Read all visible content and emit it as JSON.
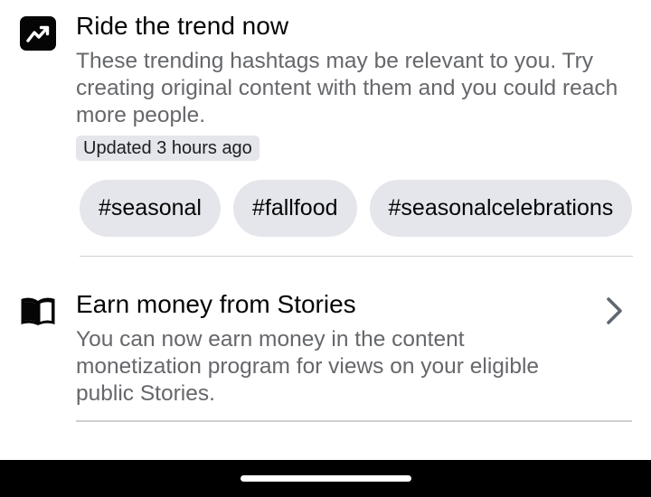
{
  "trend_card": {
    "icon": "trending-up-icon",
    "title": "Ride the trend now",
    "description": "These trending hashtags may be relevant to you. Try creating original content with them and you could reach more people.",
    "updated": "Updated 3 hours ago",
    "hashtags": [
      {
        "label": "#seasonal"
      },
      {
        "label": "#fallfood"
      },
      {
        "label": "#seasonalcelebrations"
      }
    ]
  },
  "stories_card": {
    "icon": "book-icon",
    "title": "Earn money from Stories",
    "description": "You can now earn money in the content monetization program for views on your eligible public Stories.",
    "action_icon": "chevron-right-icon"
  },
  "system_nav": {
    "home_indicator": "home-indicator"
  },
  "colors": {
    "text_primary": "#050505",
    "text_secondary": "#65676b",
    "chip_background": "#e4e6eb",
    "divider": "#ced0d4",
    "nav_bar": "#000000"
  }
}
